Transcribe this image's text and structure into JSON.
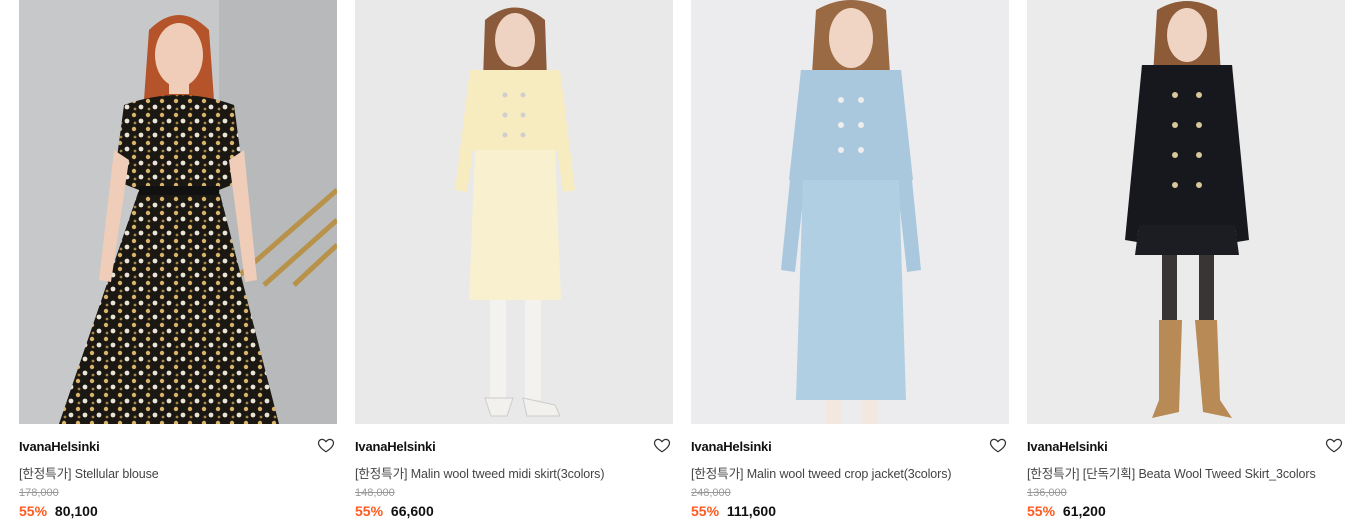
{
  "colors": {
    "discount": "#ff5a1f",
    "accent_text": "#111111"
  },
  "products": [
    {
      "brand": "IvanaHelsinki",
      "name": "[한정특가] Stellular blouse",
      "original_price": "178,000",
      "discount": "55%",
      "price": "80,100",
      "photo_desc": "floral dress, gray background",
      "wishlist_icon": "heart-outline-icon"
    },
    {
      "brand": "IvanaHelsinki",
      "name": "[한정특가] Malin wool tweed midi skirt(3colors)",
      "original_price": "148,000",
      "discount": "55%",
      "price": "66,600",
      "photo_desc": "cream tweed jacket and skirt",
      "wishlist_icon": "heart-outline-icon"
    },
    {
      "brand": "IvanaHelsinki",
      "name": "[한정특가] Malin wool tweed crop jacket(3colors)",
      "original_price": "248,000",
      "discount": "55%",
      "price": "111,600",
      "photo_desc": "light blue tweed jacket and skirt",
      "wishlist_icon": "heart-outline-icon"
    },
    {
      "brand": "IvanaHelsinki",
      "name": "[한정특가] [단독기획] Beata Wool Tweed Skirt_3colors",
      "original_price": "136,000",
      "discount": "55%",
      "price": "61,200",
      "photo_desc": "black tweed jacket with brown boots",
      "wishlist_icon": "heart-outline-icon"
    }
  ]
}
